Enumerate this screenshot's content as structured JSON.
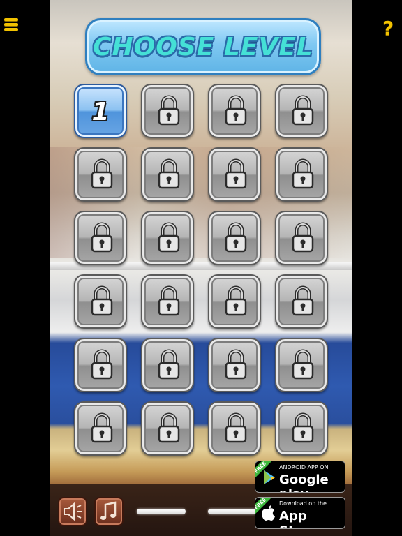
{
  "header": {
    "title": "CHOOSE LEVEL",
    "help_label": "?"
  },
  "levels": [
    {
      "label": "1",
      "locked": false
    },
    {
      "label": "",
      "locked": true
    },
    {
      "label": "",
      "locked": true
    },
    {
      "label": "",
      "locked": true
    },
    {
      "label": "",
      "locked": true
    },
    {
      "label": "",
      "locked": true
    },
    {
      "label": "",
      "locked": true
    },
    {
      "label": "",
      "locked": true
    },
    {
      "label": "",
      "locked": true
    },
    {
      "label": "",
      "locked": true
    },
    {
      "label": "",
      "locked": true
    },
    {
      "label": "",
      "locked": true
    },
    {
      "label": "",
      "locked": true
    },
    {
      "label": "",
      "locked": true
    },
    {
      "label": "",
      "locked": true
    },
    {
      "label": "",
      "locked": true
    },
    {
      "label": "",
      "locked": true
    },
    {
      "label": "",
      "locked": true
    },
    {
      "label": "",
      "locked": true
    },
    {
      "label": "",
      "locked": true
    },
    {
      "label": "",
      "locked": true
    },
    {
      "label": "",
      "locked": true
    },
    {
      "label": "",
      "locked": true
    },
    {
      "label": "",
      "locked": true
    }
  ],
  "stores": {
    "google": {
      "badge": "FREE",
      "small": "ANDROID APP ON",
      "big": "Google play"
    },
    "apple": {
      "badge": "FREE",
      "small": "Download on the",
      "big": "App Store"
    }
  },
  "controls": {
    "sound_icon": "speaker-icon",
    "music_icon": "music-note-icon"
  }
}
